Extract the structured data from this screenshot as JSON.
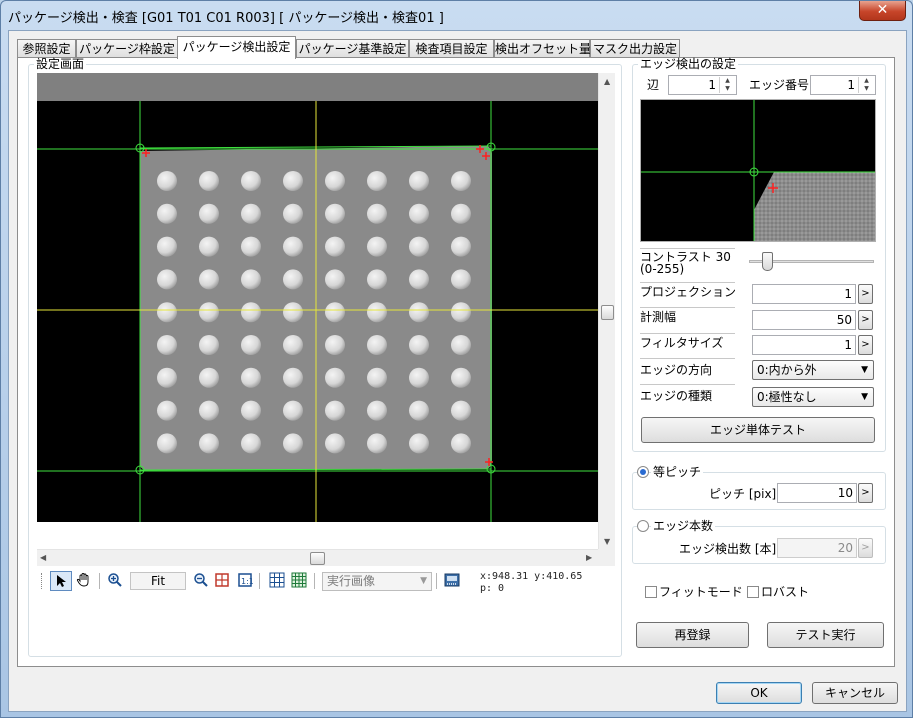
{
  "window": {
    "title": "パッケージ検出・検査 [G01 T01 C01 R003] [ パッケージ検出・検査01 ]",
    "close_glyph": "✕"
  },
  "tabs": [
    {
      "label": "参照設定",
      "active": false
    },
    {
      "label": "パッケージ枠設定",
      "active": false
    },
    {
      "label": "パッケージ検出設定",
      "active": true
    },
    {
      "label": "パッケージ基準設定",
      "active": false
    },
    {
      "label": "検査項目設定",
      "active": false
    },
    {
      "label": "検出オフセット量",
      "active": false
    },
    {
      "label": "マスク出力設定",
      "active": false
    }
  ],
  "viewer": {
    "group_label": "設定画面",
    "grid_rows": 9,
    "grid_cols": 8
  },
  "toolbar": {
    "fit_label": "Fit",
    "exec_image_label": "実行画像",
    "coord_text": "x:948.31 y:410.65",
    "pixel_text": "p:  0",
    "icons": [
      "pointer-icon",
      "hand-icon",
      "zoom-in-icon",
      "zoom-out-icon",
      "zoom-box-icon",
      "one-to-one-icon",
      "grid-icon",
      "fine-grid-icon",
      "save-image-icon"
    ]
  },
  "edge_settings": {
    "group_label": "エッジ検出の設定",
    "side_label": "辺",
    "side_value": "1",
    "edge_number_label": "エッジ番号",
    "edge_number_value": "1",
    "contrast_label": "コントラスト 30",
    "contrast_range": "(0-255)",
    "contrast_value": 30,
    "contrast_max": 255,
    "projection_label": "プロジェクション",
    "projection_value": "1",
    "measure_width_label": "計測幅",
    "measure_width_value": "50",
    "filter_size_label": "フィルタサイズ",
    "filter_size_value": "1",
    "edge_direction_label": "エッジの方向",
    "edge_direction_value": "0:内から外",
    "edge_type_label": "エッジの種類",
    "edge_type_value": "0:極性なし",
    "single_test_button": "エッジ単体テスト"
  },
  "pitch": {
    "equal_pitch_label": "等ピッチ",
    "equal_pitch_selected": true,
    "pitch_label": "ピッチ [pix]",
    "pitch_value": "10",
    "edge_count_label": "エッジ本数",
    "edge_count_selected": false,
    "edge_detect_count_label": "エッジ検出数 [本]",
    "edge_detect_count_value": "20"
  },
  "options": {
    "fit_mode_label": "フィットモード",
    "fit_mode_checked": false,
    "robust_label": "ロバスト",
    "robust_checked": false
  },
  "buttons": {
    "reregister": "再登録",
    "test_run": "テスト実行",
    "ok": "OK",
    "cancel": "キャンセル",
    "spin_btn": ">"
  },
  "colors": {
    "guide_green": "#3fe23f",
    "guide_yellow": "#e6e63a",
    "marker_red": "#ff2020",
    "package_gray": "#8a8a8a",
    "ball_light": "#dcdcdc"
  }
}
